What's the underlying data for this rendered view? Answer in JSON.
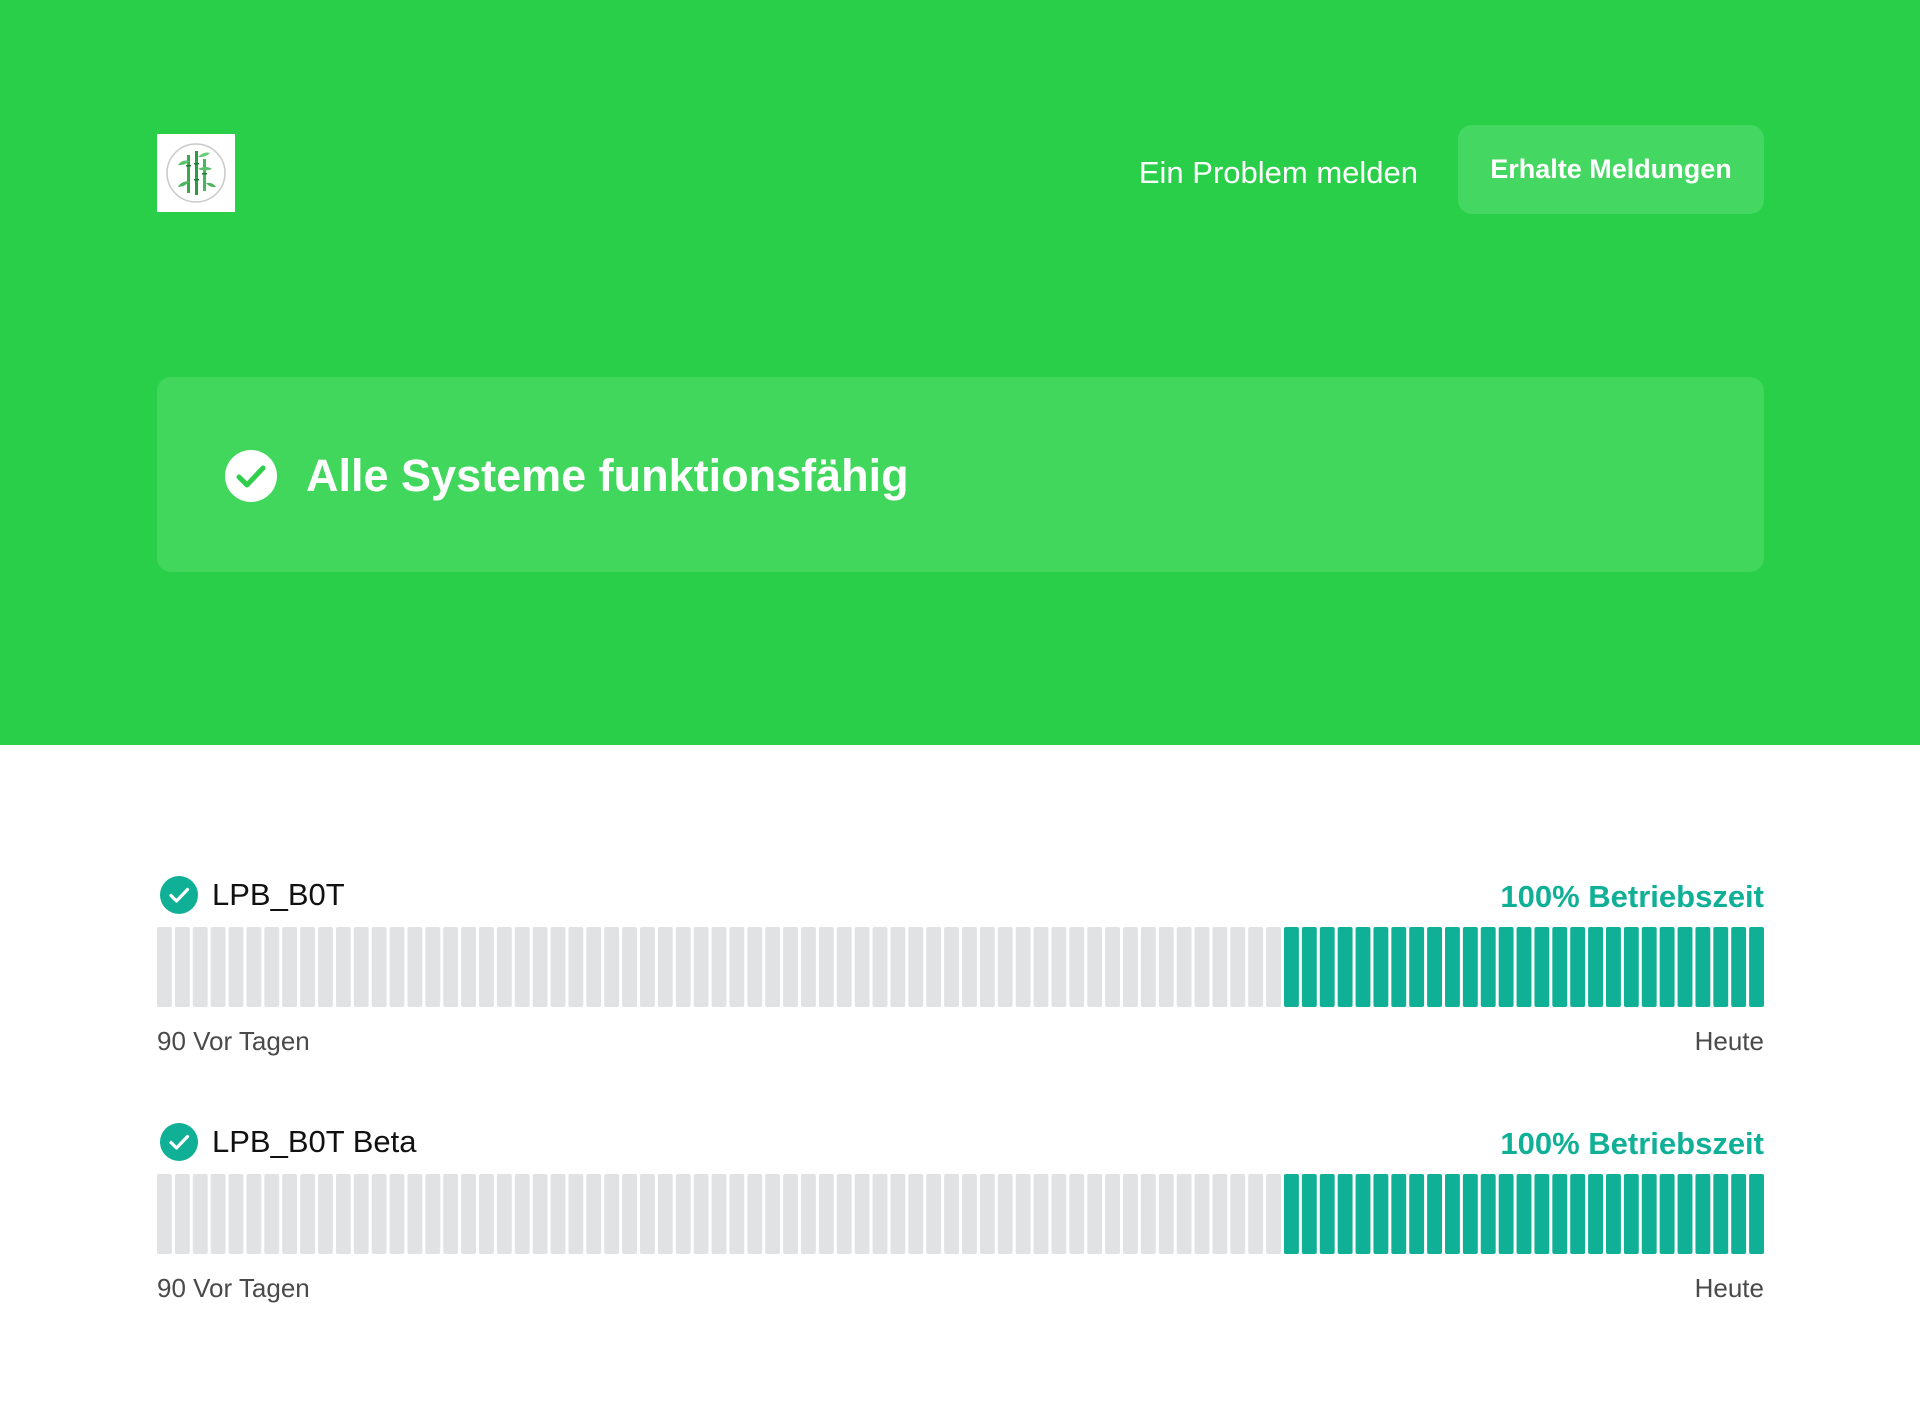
{
  "header": {
    "logo_icon": "bamboo-logo-icon",
    "report_link": "Ein Problem melden",
    "subscribe_button": "Erhalte Meldungen"
  },
  "status": {
    "icon": "check-circle-icon",
    "text": "Alle Systeme funktionsfähig"
  },
  "colors": {
    "hero_green": "#29cf48",
    "panel_green": "#40d75c",
    "uptime_teal": "#0fb096",
    "empty_bar": "#e1e2e3"
  },
  "components": [
    {
      "name": "LPB_B0T",
      "uptime": "100% Betriebszeit",
      "range_start": "90 Vor Tagen",
      "range_end": "Heute",
      "days_total": 90,
      "days_operational": 27,
      "status_icon": "check-circle-icon"
    },
    {
      "name": "LPB_B0T Beta",
      "uptime": "100% Betriebszeit",
      "range_start": "90 Vor Tagen",
      "range_end": "Heute",
      "days_total": 90,
      "days_operational": 27,
      "status_icon": "check-circle-icon"
    }
  ]
}
